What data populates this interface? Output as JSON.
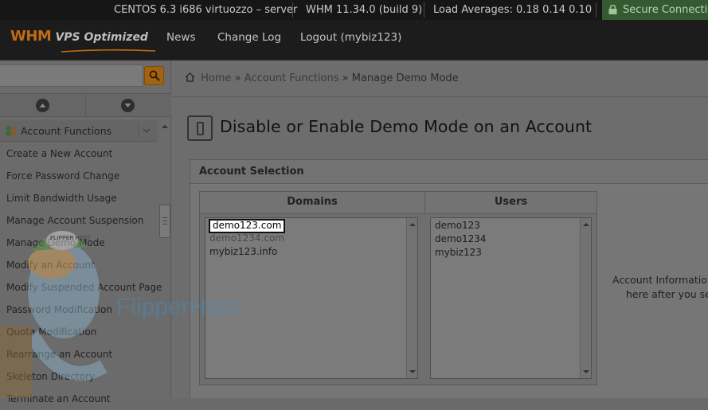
{
  "statusbar": {
    "server": "CENTOS 6.3 i686 virtuozzo – server",
    "version": "WHM 11.34.0 (build 9)",
    "load": "Load Averages: 0.18 0.14 0.10",
    "secure": "Secure Connection"
  },
  "header": {
    "logo_whm": "WHM",
    "logo_vps": "VPS Optimized",
    "nav": [
      {
        "label": "News"
      },
      {
        "label": "Change Log"
      },
      {
        "label": "Logout (mybiz123)"
      }
    ]
  },
  "sidebar": {
    "search": {
      "value": "",
      "placeholder": ""
    },
    "section_title": "Account Functions",
    "items": [
      {
        "label": "Create a New Account"
      },
      {
        "label": "Force Password Change"
      },
      {
        "label": "Limit Bandwidth Usage"
      },
      {
        "label": "Manage Account Suspension"
      },
      {
        "label": "Manage Demo Mode"
      },
      {
        "label": "Modify an Account"
      },
      {
        "label": "Modify Suspended Account Page"
      },
      {
        "label": "Password Modification"
      },
      {
        "label": "Quota Modification"
      },
      {
        "label": "Rearrange an Account"
      },
      {
        "label": "Skeleton Directory"
      },
      {
        "label": "Terminate an Account"
      }
    ]
  },
  "watermark": {
    "text": "FlipperHost",
    "badge": "FLIPPER HOST"
  },
  "breadcrumb": {
    "home": "Home",
    "sep": "»",
    "level1": "Account Functions",
    "current": "Manage Demo Mode"
  },
  "page": {
    "title": "Disable or Enable Demo Mode on an Account"
  },
  "panel": {
    "title": "Account Selection",
    "domains_header": "Domains",
    "users_header": "Users",
    "domains": [
      {
        "label": "demo123.com",
        "selected": true
      },
      {
        "label": "demo1234.com"
      },
      {
        "label": "mybiz123.info"
      }
    ],
    "users": [
      {
        "label": "demo123"
      },
      {
        "label": "demo1234"
      },
      {
        "label": "mybiz123"
      }
    ],
    "info_line1": "Account Information",
    "info_line2": "here after you se"
  },
  "colors": {
    "statusbar_bg": "#161616",
    "secure_bg": "#355a33",
    "brand_orange": "#c06a14",
    "overlay_gray": "#6d6d6d"
  }
}
